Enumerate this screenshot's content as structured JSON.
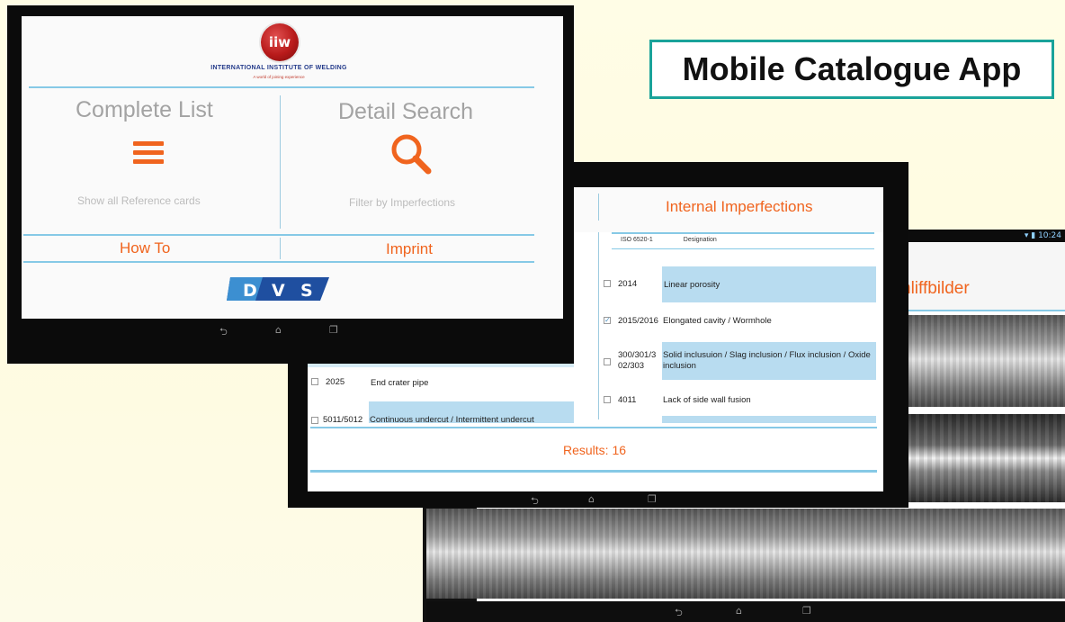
{
  "title": "Mobile Catalogue App",
  "tablet_home": {
    "logo_initials": "iiw",
    "logo_name": "INTERNATIONAL INSTITUTE OF WELDING",
    "logo_tagline": "A world of joining experience",
    "tile_left": {
      "title": "Complete List",
      "subtitle": "Show all Reference cards",
      "icon": "menu-icon"
    },
    "tile_right": {
      "title": "Detail Search",
      "subtitle": "Filter by Imperfections",
      "icon": "search-icon"
    },
    "link_left": "How To",
    "link_right": "Imprint",
    "sponsor_logo": "DVS"
  },
  "tablet_list": {
    "heading": "Internal Imperfections",
    "col_code": "ISO 6520-1",
    "col_designation": "Designation",
    "rows": [
      {
        "code": "2014",
        "name": "Linear porosity",
        "checked": false
      },
      {
        "code": "2015/2016",
        "name": "Elongated cavity / Wormhole",
        "checked": true
      },
      {
        "code": "300/301/3\n02/303",
        "name": "Solid inclusuion / Slag inclusion / Flux inclusion / Oxide inclusion",
        "checked": false
      },
      {
        "code": "4011",
        "name": "Lack of side wall fusion",
        "checked": false
      }
    ],
    "left_rows": [
      {
        "code": "2025",
        "name": "End crater pipe",
        "checked": false
      },
      {
        "code": "5011/5012",
        "name": "Continuous undercut / Intermittent undercut",
        "checked": false
      }
    ],
    "results": "Results: 16"
  },
  "tablet_photos": {
    "status_time": "10:24",
    "heading": "hliffbilder"
  },
  "colors": {
    "accent": "#f0641e",
    "divider": "#86c9e6",
    "title_border": "#1aa39a"
  }
}
